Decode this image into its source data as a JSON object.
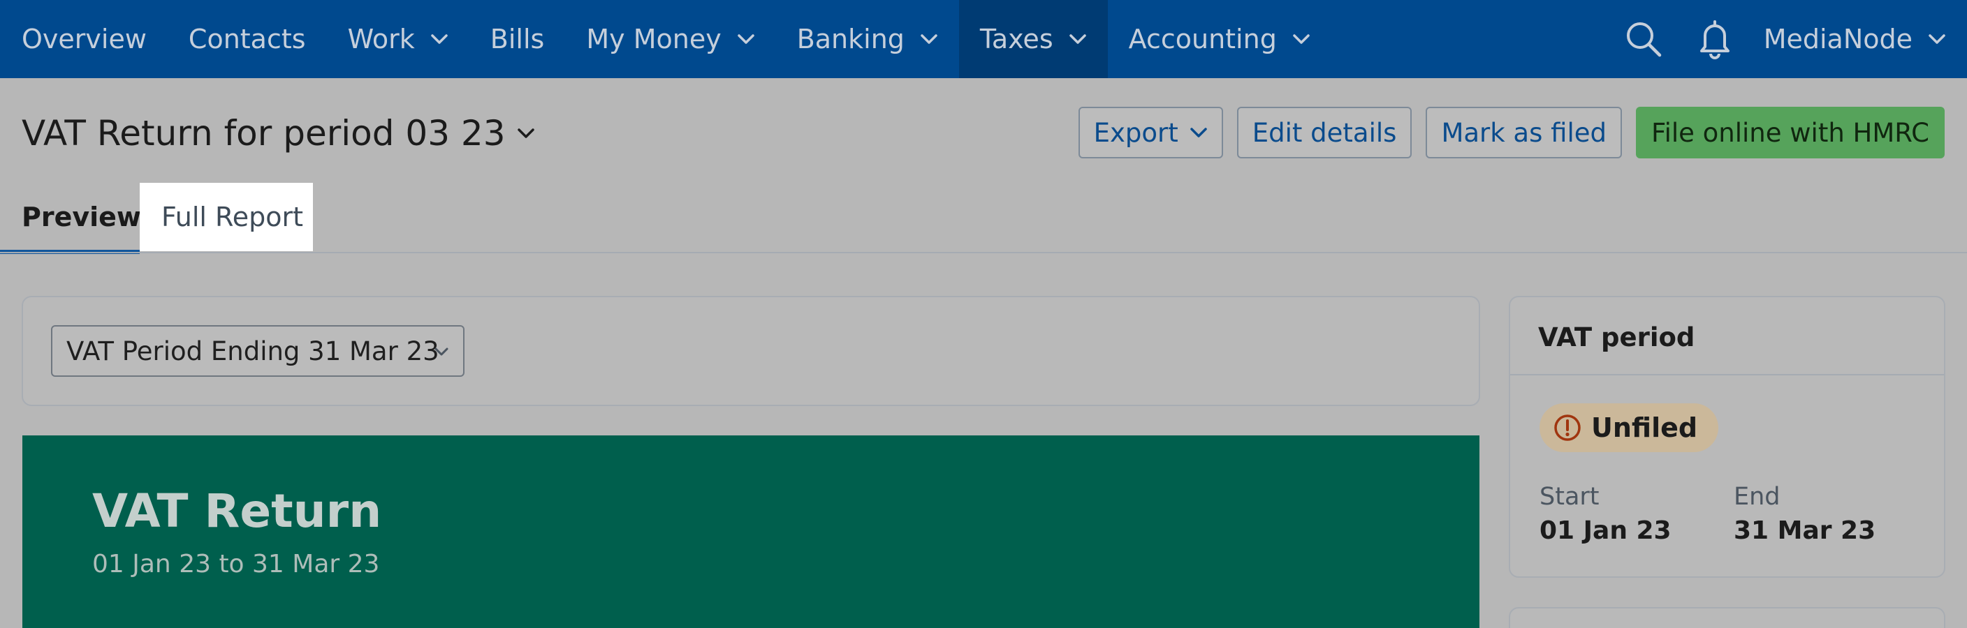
{
  "nav": {
    "items": [
      {
        "label": "Overview",
        "dropdown": false,
        "active": false
      },
      {
        "label": "Contacts",
        "dropdown": false,
        "active": false
      },
      {
        "label": "Work",
        "dropdown": true,
        "active": false
      },
      {
        "label": "Bills",
        "dropdown": false,
        "active": false
      },
      {
        "label": "My Money",
        "dropdown": true,
        "active": false
      },
      {
        "label": "Banking",
        "dropdown": true,
        "active": false
      },
      {
        "label": "Taxes",
        "dropdown": true,
        "active": true
      },
      {
        "label": "Accounting",
        "dropdown": true,
        "active": false
      }
    ],
    "user": "MediaNode"
  },
  "header": {
    "title": "VAT Return for period 03 23",
    "actions": {
      "export": "Export",
      "edit": "Edit details",
      "mark_filed": "Mark as filed",
      "file_online": "File online with HMRC"
    }
  },
  "tabs": {
    "preview": "Preview",
    "full_report": "Full Report"
  },
  "filter": {
    "selected_period": "VAT Period Ending 31 Mar 23"
  },
  "banner": {
    "title": "VAT Return",
    "subtitle": "01 Jan 23 to 31 Mar 23"
  },
  "vat_period": {
    "title": "VAT period",
    "status": "Unfiled",
    "start_label": "Start",
    "start_value": "01 Jan 23",
    "end_label": "End",
    "end_value": "31 Mar 23"
  },
  "colors": {
    "nav_bg": "#00498e",
    "banner_bg": "#005f4d",
    "primary_button": "#56a35b",
    "status_badge": "#cbb89a"
  }
}
